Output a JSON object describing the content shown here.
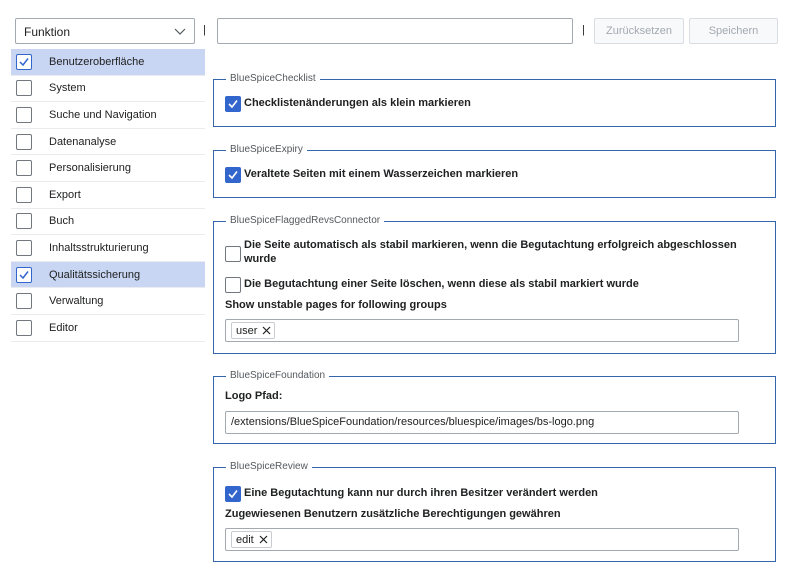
{
  "toolbar": {
    "select_value": "Funktion",
    "separator": "|",
    "search_value": "",
    "reset_label": "Zurücksetzen",
    "save_label": "Speichern"
  },
  "sidebar": {
    "items": [
      {
        "label": "Benutzeroberfläche",
        "checked": true,
        "active": true
      },
      {
        "label": "System",
        "checked": false
      },
      {
        "label": "Suche und Navigation",
        "checked": false
      },
      {
        "label": "Datenanalyse",
        "checked": false
      },
      {
        "label": "Personalisierung",
        "checked": false
      },
      {
        "label": "Export",
        "checked": false
      },
      {
        "label": "Buch",
        "checked": false
      },
      {
        "label": "Inhaltsstrukturierung",
        "checked": false
      },
      {
        "label": "Qualitätssicherung",
        "checked": true,
        "active": true
      },
      {
        "label": "Verwaltung",
        "checked": false
      },
      {
        "label": "Editor",
        "checked": false
      }
    ]
  },
  "sections": {
    "checklist": {
      "legend": "BlueSpiceChecklist",
      "option1": "Checklistenänderungen als klein markieren",
      "option1_checked": true
    },
    "expiry": {
      "legend": "BlueSpiceExpiry",
      "option1": "Veraltete Seiten mit einem Wasserzeichen markieren",
      "option1_checked": true
    },
    "flagged": {
      "legend": "BlueSpiceFlaggedRevsConnector",
      "option1": "Die Seite automatisch als stabil markieren, wenn die Begutachtung erfolgreich abgeschlossen wurde",
      "option1_checked": false,
      "option2": "Die Begutachtung einer Seite löschen, wenn diese als stabil markiert wurde",
      "option2_checked": false,
      "groups_label": "Show unstable pages for following groups",
      "groups_tag": "user"
    },
    "foundation": {
      "legend": "BlueSpiceFoundation",
      "logo_label": "Logo Pfad:",
      "logo_value": "/extensions/BlueSpiceFoundation/resources/bluespice/images/bs-logo.png"
    },
    "review": {
      "legend": "BlueSpiceReview",
      "option1": "Eine Begutachtung kann nur durch ihren Besitzer verändert werden",
      "option1_checked": true,
      "perm_label": "Zugewiesenen Benutzern zusätzliche Berechtigungen gewähren",
      "perm_tag": "edit"
    }
  },
  "colors": {
    "accent": "#3366cc",
    "active_row": "#c8d6f3",
    "fieldset_border": "#3366aa"
  }
}
